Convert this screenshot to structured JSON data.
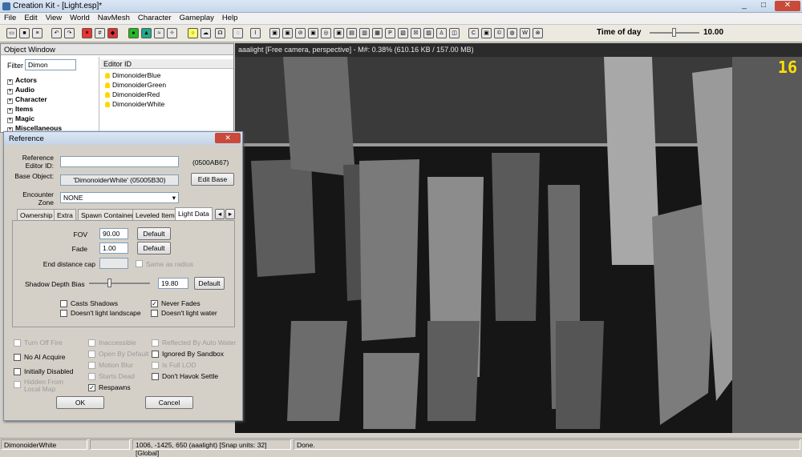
{
  "window": {
    "title": "Creation Kit - [Light.esp]*"
  },
  "menu": [
    "File",
    "Edit",
    "View",
    "World",
    "NavMesh",
    "Character",
    "Gameplay",
    "Help"
  ],
  "toolbar": {
    "time_label": "Time of day",
    "time_value": "10.00"
  },
  "object_window": {
    "title": "Object Window",
    "filter_label": "Filter",
    "filter_value": "Dimon",
    "column": "Editor ID",
    "tree": [
      "Actors",
      "Audio",
      "Character",
      "Items",
      "Magic",
      "Miscellaneous"
    ],
    "items": [
      "DimonoiderBlue",
      "DimonoiderGreen",
      "DimonoiderRed",
      "DimonoiderWhite"
    ]
  },
  "viewport": {
    "header": "aaalight [Free camera, perspective] - M#: 0.38% (610.16 KB / 157.00 MB)",
    "fps": "16"
  },
  "dialog": {
    "title": "Reference",
    "close": "✕",
    "editor_id_label": "Reference Editor ID:",
    "editor_id_value": "",
    "form_id": "(0500AB67)",
    "base_label": "Base Object:",
    "base_value": "'DimonoiderWhite' (05005B30)",
    "edit_base": "Edit Base",
    "zone_label": "Encounter Zone",
    "zone_value": "NONE",
    "tabs": [
      "Ownership",
      "Extra",
      "Spawn Container",
      "Leveled Item",
      "Light Data"
    ],
    "fov_label": "FOV",
    "fov_value": "90.00",
    "fade_label": "Fade",
    "fade_value": "1.00",
    "default": "Default",
    "end_cap_label": "End distance cap",
    "same_radius": "Same as radius",
    "shadow_label": "Shadow Depth Bias",
    "shadow_value": "19.80",
    "shadow_level": 0.32,
    "casts_shadows": "Casts Shadows",
    "never_fades": "Never Fades",
    "no_landscape": "Doesn't light landscape",
    "no_water": "Doesn't light water",
    "flags": {
      "turn_off_fire": "Turn Off Fire",
      "inaccessible": "Inaccessible",
      "reflected": "Reflected By Auto Water",
      "no_ai": "No AI Acquire",
      "open_default": "Open By Default",
      "ignored_sandbox": "Ignored By Sandbox",
      "init_disabled": "Initially Disabled",
      "motion_blur": "Motion Blur",
      "full_lod": "Is Full LOD",
      "hidden_map": "Hidden From Local Map",
      "starts_dead": "Starts Dead",
      "no_havok": "Don't Havok Settle",
      "respawns": "Respawns"
    },
    "ok": "OK",
    "cancel": "Cancel"
  },
  "status": {
    "selected": "DimonoiderWhite",
    "coords": "1006, -1425, 650 (aaalight) [Snap units: 32] [Global]",
    "state": "Done."
  }
}
